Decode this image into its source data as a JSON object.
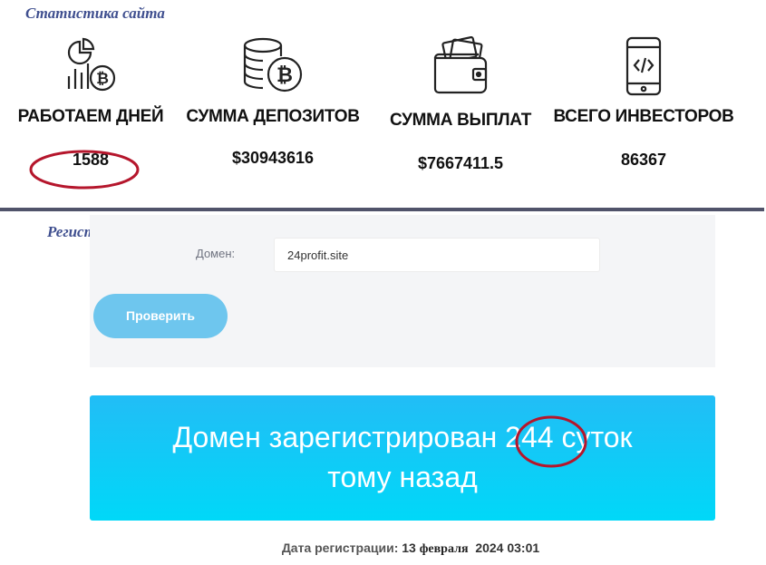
{
  "stats_section": {
    "caption": "Статистика сайта",
    "items": [
      {
        "label": "РАБОТАЕМ ДНЕЙ",
        "value": "1588",
        "icon": "chart-bitcoin-icon"
      },
      {
        "label": "СУММА ДЕПОЗИТОВ",
        "value": "$30943616",
        "icon": "coins-bitcoin-icon"
      },
      {
        "label": "СУММА ВЫПЛАТ",
        "value": "$7667411.5",
        "icon": "wallet-cash-icon"
      },
      {
        "label": "ВСЕГО ИНВЕСТОРОВ",
        "value": "86367",
        "icon": "smartphone-code-icon"
      }
    ]
  },
  "registration": {
    "caption": "Регистрация",
    "domain_label": "Домен:",
    "domain_value": "24profit.site",
    "check_button": "Проверить",
    "result_prefix": "Домен зарегистрирован",
    "result_days": "244",
    "result_suffix": "суток",
    "result_line2": "тому назад",
    "date_label": "Дата регистрации:",
    "date_day": "13",
    "date_month": "февраля",
    "date_rest": "2024 03:01"
  },
  "colors": {
    "banner": "#22bdf6",
    "button": "#6ec6ee",
    "highlight_ellipse": "#b5162c",
    "caption": "#3f4f8f"
  }
}
